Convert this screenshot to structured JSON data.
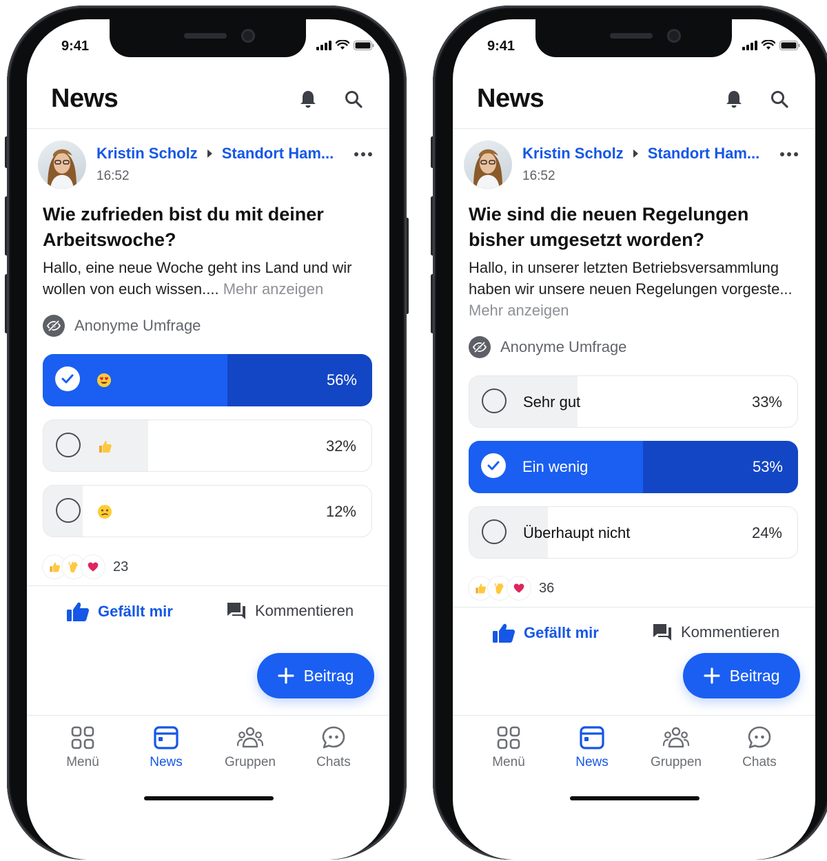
{
  "phones": [
    {
      "status": {
        "time": "9:41"
      },
      "header": {
        "title": "News"
      },
      "post": {
        "author": "Kristin Scholz",
        "location": "Standort Ham...",
        "time": "16:52",
        "question": "Wie zufrieden bist du mit deiner Arbeitswoche?",
        "body": "Hallo, eine neue Woche geht ins Land und wir wollen von euch wissen....",
        "more": "Mehr anzeigen",
        "anonymous_label": "Anonyme Umfrage",
        "options": [
          {
            "label": "😍",
            "icon": "heart-eyes-emoji",
            "percent": "56%",
            "value": 0.56,
            "selected": true
          },
          {
            "label": "👍",
            "icon": "thumbs-up-emoji",
            "percent": "32%",
            "value": 0.32,
            "selected": false
          },
          {
            "label": "😕",
            "icon": "confused-face-emoji",
            "percent": "12%",
            "value": 0.12,
            "selected": false
          }
        ],
        "reaction_icons": [
          "thumbs-up",
          "clapping-hands",
          "heart"
        ],
        "reaction_count": "23",
        "like_label": "Gefällt mir",
        "comment_label": "Kommentieren"
      },
      "fab_label": "Beitrag",
      "tabs": [
        {
          "label": "Menü",
          "icon": "grid-icon"
        },
        {
          "label": "News",
          "icon": "news-icon",
          "active": true
        },
        {
          "label": "Gruppen",
          "icon": "people-icon"
        },
        {
          "label": "Chats",
          "icon": "chat-icon"
        }
      ]
    },
    {
      "status": {
        "time": "9:41"
      },
      "header": {
        "title": "News"
      },
      "post": {
        "author": "Kristin Scholz",
        "location": "Standort Ham...",
        "time": "16:52",
        "question": "Wie sind die neuen Regelungen bisher umgesetzt worden?",
        "body": "Hallo, in unserer letzten Betriebsversammlung haben wir unsere neuen Regelungen vorgeste...",
        "more": "Mehr anzeigen",
        "anonymous_label": "Anonyme Umfrage",
        "options": [
          {
            "label": "Sehr gut",
            "percent": "33%",
            "value": 0.33,
            "selected": false
          },
          {
            "label": "Ein wenig",
            "percent": "53%",
            "value": 0.53,
            "selected": true
          },
          {
            "label": "Überhaupt nicht",
            "percent": "24%",
            "value": 0.24,
            "selected": false
          }
        ],
        "reaction_icons": [
          "thumbs-up",
          "clapping-hands",
          "heart"
        ],
        "reaction_count": "36",
        "like_label": "Gefällt mir",
        "comment_label": "Kommentieren"
      },
      "fab_label": "Beitrag",
      "tabs": [
        {
          "label": "Menü",
          "icon": "grid-icon"
        },
        {
          "label": "News",
          "icon": "news-icon",
          "active": true
        },
        {
          "label": "Gruppen",
          "icon": "people-icon"
        },
        {
          "label": "Chats",
          "icon": "chat-icon"
        }
      ]
    }
  ],
  "colors": {
    "accent": "#1a5ff2",
    "accent_dark": "#1346c4",
    "link": "#1557e6"
  }
}
